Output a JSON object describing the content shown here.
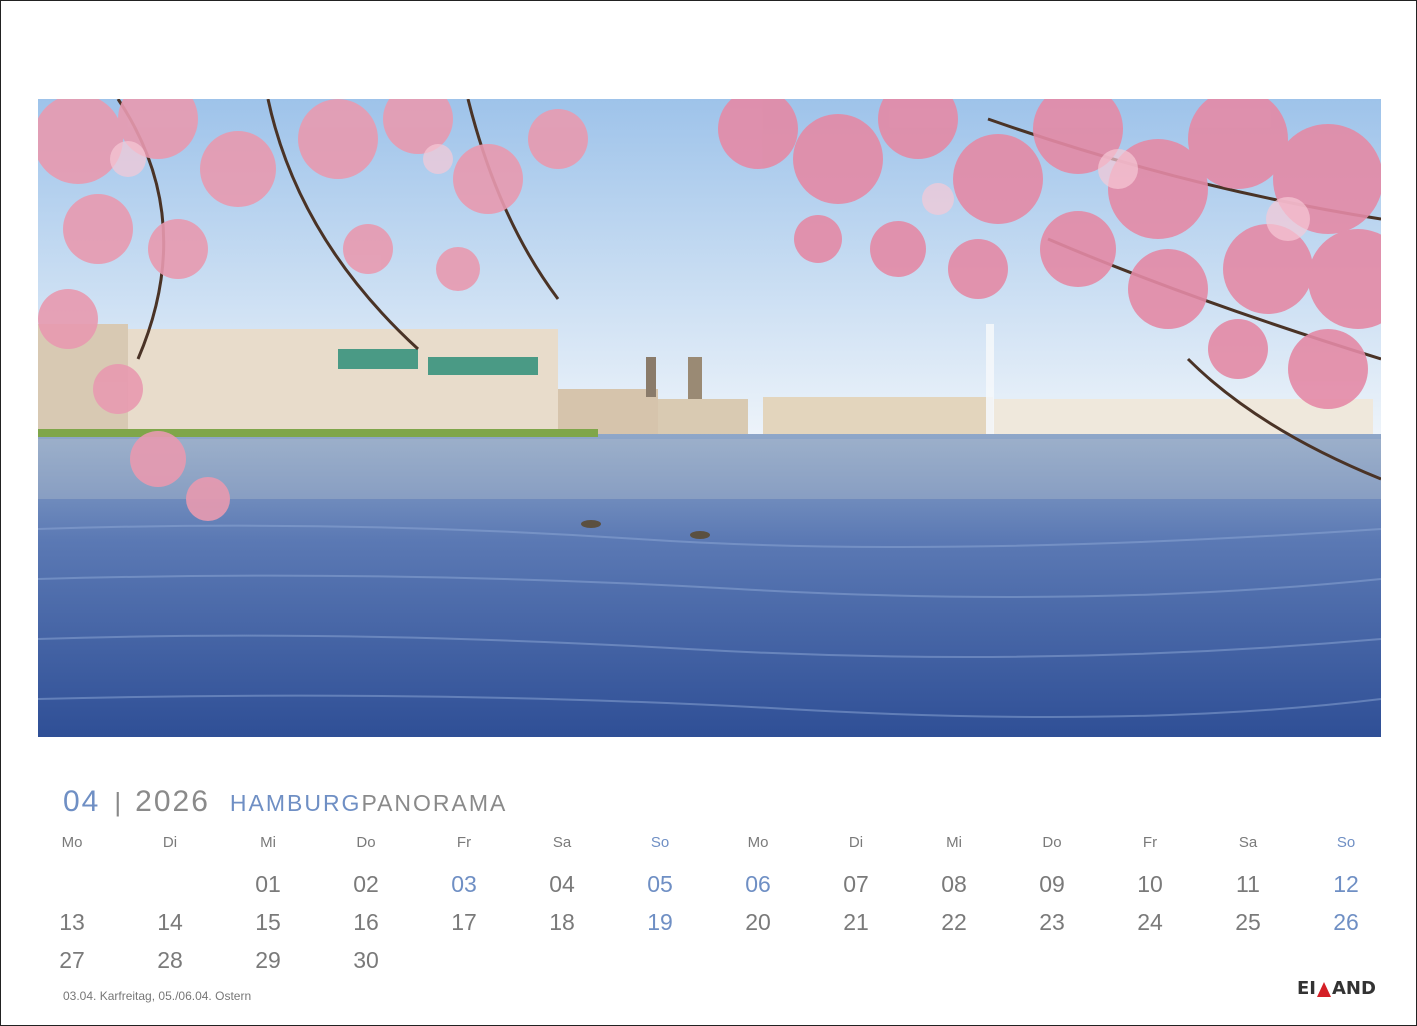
{
  "header": {
    "month": "04",
    "separator": "|",
    "year": "2026",
    "title_bold": "HAMBURG",
    "title_light": "PANORAMA"
  },
  "weekdays": [
    "Mo",
    "Di",
    "Mi",
    "Do",
    "Fr",
    "Sa",
    "So",
    "Mo",
    "Di",
    "Mi",
    "Do",
    "Fr",
    "Sa",
    "So"
  ],
  "rows": [
    [
      "",
      "",
      "01",
      "02",
      "03",
      "04",
      "05",
      "06",
      "07",
      "08",
      "09",
      "10",
      "11",
      "12"
    ],
    [
      "13",
      "14",
      "15",
      "16",
      "17",
      "18",
      "19",
      "20",
      "21",
      "22",
      "23",
      "24",
      "25",
      "26"
    ],
    [
      "27",
      "28",
      "29",
      "30",
      "",
      "",
      "",
      "",
      "",
      "",
      "",
      "",
      "",
      ""
    ]
  ],
  "highlighted_days": [
    "03",
    "05",
    "06",
    "12",
    "19",
    "26"
  ],
  "footnote": "03.04. Karfreitag, 05./06.04. Ostern",
  "logo": {
    "before": "EI",
    "after": "AND"
  },
  "colors": {
    "accent": "#6f8fc4",
    "text": "#7a7a7a",
    "logo_red": "#d41f26"
  }
}
